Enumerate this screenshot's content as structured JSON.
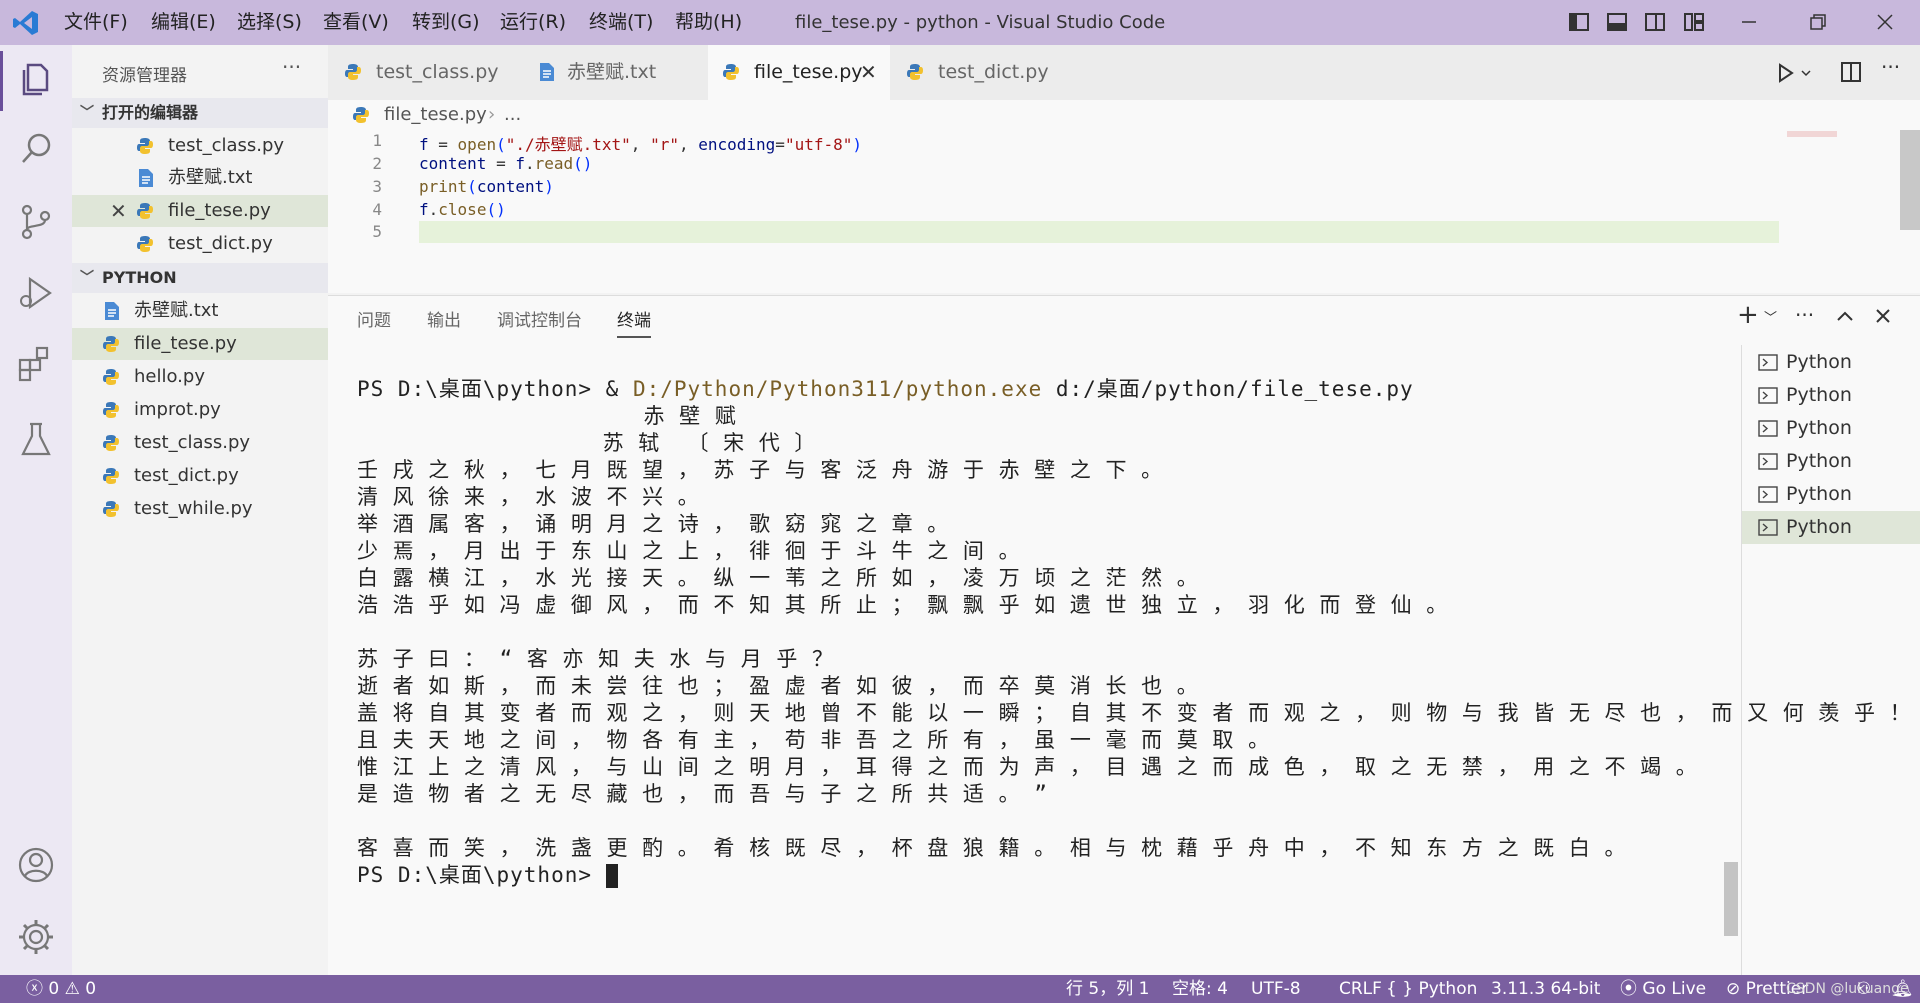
{
  "titlebar": {
    "menus": [
      "文件(F)",
      "编辑(E)",
      "选择(S)",
      "查看(V)",
      "转到(G)",
      "运行(R)",
      "终端(T)",
      "帮助(H)"
    ],
    "title": "file_tese.py - python - Visual Studio Code"
  },
  "activity_icons": [
    "explorer-icon",
    "search-icon",
    "source-control-icon",
    "run-debug-icon",
    "extensions-icon",
    "testing-icon",
    "account-icon",
    "gear-icon"
  ],
  "sidebar": {
    "header": "资源管理器",
    "open_editors_title": "打开的编辑器",
    "open_editors": [
      "test_class.py",
      "赤壁赋.txt",
      "file_tese.py",
      "test_dict.py"
    ],
    "folder_title": "PYTHON",
    "files": [
      "赤壁赋.txt",
      "file_tese.py",
      "hello.py",
      "improt.py",
      "test_class.py",
      "test_dict.py",
      "test_while.py"
    ]
  },
  "tabs": [
    "test_class.py",
    "赤壁赋.txt",
    "file_tese.py",
    "test_dict.py"
  ],
  "breadcrumb": {
    "file": "file_tese.py",
    "rest": "..."
  },
  "editor": {
    "line_numbers": [
      "1",
      "2",
      "3",
      "4",
      "5"
    ]
  },
  "panel": {
    "tabs": [
      "问题",
      "输出",
      "调试控制台",
      "终端"
    ],
    "terminal_lines": [
      "PS D:\\桌面\\python> & ",
      "D:/Python/Python311/python.exe",
      " d:/桌面/python/file_tese.py",
      "                     赤 壁 赋",
      "                  苏 轼  〔 宋 代 〕",
      "壬 戌 之 秋 ， 七 月 既 望 ， 苏 子 与 客 泛 舟 游 于 赤 壁 之 下 。",
      "清 风 徐 来 ， 水 波 不 兴 。",
      "举 酒 属 客 ， 诵 明 月 之 诗 ， 歌 窈 窕 之 章 。",
      "少 焉 ， 月 出 于 东 山 之 上 ， 徘 徊 于 斗 牛 之 间 。",
      "白 露 横 江 ， 水 光 接 天 。 纵 一 苇 之 所 如 ， 凌 万 顷 之 茫 然 。",
      "浩 浩 乎 如 冯 虚 御 风 ， 而 不 知 其 所 止 ； 飘 飘 乎 如 遗 世 独 立 ， 羽 化 而 登 仙 。",
      "",
      "苏 子 曰 ： “ 客 亦 知 夫 水 与 月 乎 ？",
      "逝 者 如 斯 ， 而 未 尝 往 也 ； 盈 虚 者 如 彼 ， 而 卒 莫 消 长 也 。",
      "盖 将 自 其 变 者 而 观 之 ， 则 天 地 曾 不 能 以 一 瞬 ； 自 其 不 变 者 而 观 之 ， 则 物 与 我 皆 无 尽 也 ， 而 又 何 羡 乎 ！",
      "且 夫 天 地 之 间 ， 物 各 有 主 ， 苟 非 吾 之 所 有 ， 虽 一 毫 而 莫 取 。",
      "惟 江 上 之 清 风 ， 与 山 间 之 明 月 ， 耳 得 之 而 为 声 ， 目 遇 之 而 成 色 ， 取 之 无 禁 ， 用 之 不 竭 。",
      "是 造 物 者 之 无 尽 藏 也 ， 而 吾 与 子 之 所 共 适 。 ”",
      "",
      "客 喜 而 笑 ， 洗 盏 更 酌 。 肴 核 既 尽 ， 杯 盘 狼 籍 。 相 与 枕 藉 乎 舟 中 ， 不 知 东 方 之 既 白 。",
      "PS D:\\桌面\\python> "
    ],
    "terminals": [
      "Python",
      "Python",
      "Python",
      "Python",
      "Python",
      "Python"
    ]
  },
  "statusbar": {
    "errors": "0",
    "warnings": "0",
    "position": "行 5，列 1",
    "spaces": "空格: 4",
    "encoding": "UTF-8",
    "eol": "CRLF",
    "language": "Python",
    "version": "3.11.3 64-bit",
    "golive": "Go Live",
    "prettier": "Prettier",
    "watermark": "CSDN @lukuange"
  },
  "colors": {
    "titlebar": "#c8b8dc",
    "statusbar": "#7a5fa0",
    "current_line": "#e6f2da",
    "selection": "#dfe6d8"
  }
}
